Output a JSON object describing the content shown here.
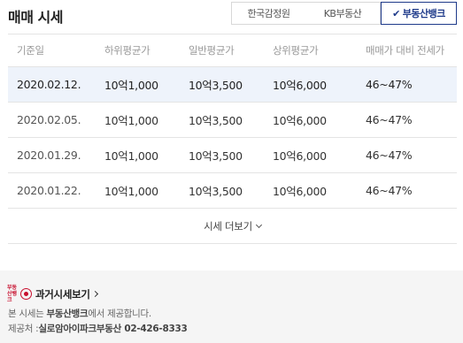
{
  "header": {
    "title": "매매 시세",
    "sources": [
      {
        "label": "한국감정원",
        "selected": false
      },
      {
        "label": "KB부동산",
        "selected": false
      },
      {
        "label": "부동산뱅크",
        "selected": true
      }
    ],
    "check_icon": "✔"
  },
  "table": {
    "columns": [
      "기준일",
      "하위평균가",
      "일반평균가",
      "상위평균가",
      "매매가 대비 전세가"
    ],
    "rows": [
      {
        "date": "2020.02.12.",
        "low": "10억1,000",
        "mid": "10억3,500",
        "high": "10억6,000",
        "ratio": "46~47%",
        "highlighted": true
      },
      {
        "date": "2020.02.05.",
        "low": "10억1,000",
        "mid": "10억3,500",
        "high": "10억6,000",
        "ratio": "46~47%",
        "highlighted": false
      },
      {
        "date": "2020.01.29.",
        "low": "10억1,000",
        "mid": "10억3,500",
        "high": "10억6,000",
        "ratio": "46~47%",
        "highlighted": false
      },
      {
        "date": "2020.01.22.",
        "low": "10억1,000",
        "mid": "10억3,500",
        "high": "10억6,000",
        "ratio": "46~47%",
        "highlighted": false
      }
    ]
  },
  "more_label": "시세 더보기",
  "footer": {
    "logo_text": "부동산뱅크",
    "past_link": "과거시세보기",
    "note1_prefix": "본 시세는 ",
    "note1_bold": "부동산뱅크",
    "note1_suffix": "에서 제공합니다.",
    "note2_prefix": "제공처 :",
    "note2_bold": "실로암아이파크부동산",
    "note2_phone": " 02-426-8333"
  },
  "colors": {
    "accent": "#1e3a8a",
    "highlight_row": "#eef3fb",
    "logo_red": "#c8102e"
  }
}
